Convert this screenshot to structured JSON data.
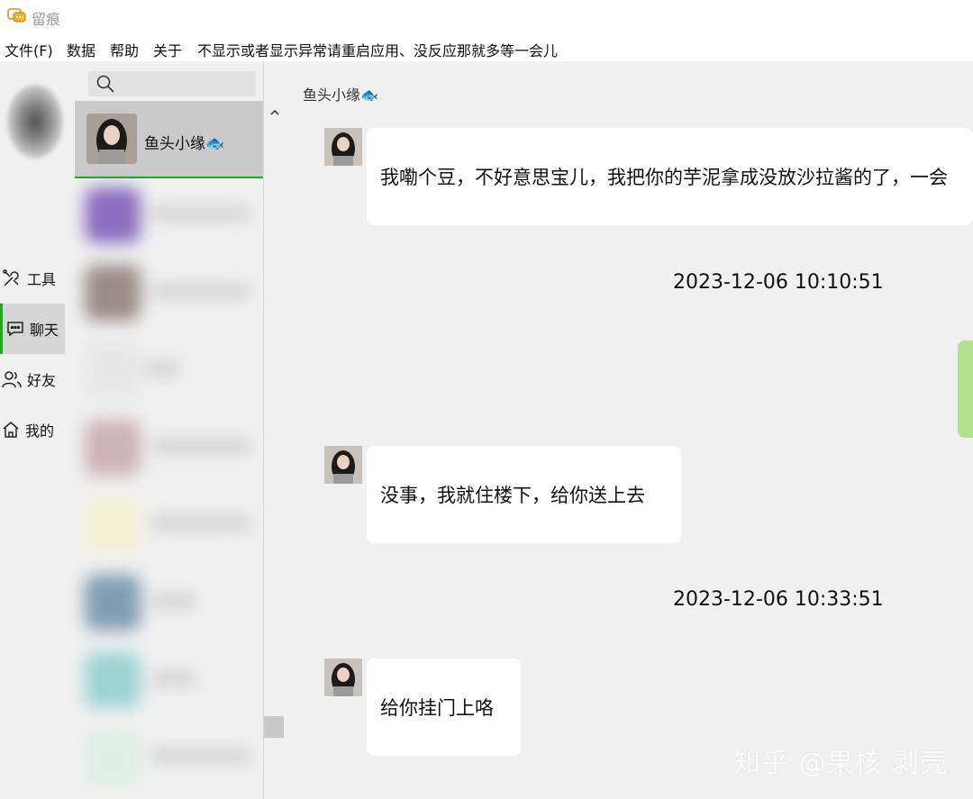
{
  "app": {
    "title": "留痕"
  },
  "menu": [
    {
      "label": "文件(F)"
    },
    {
      "label": "数据"
    },
    {
      "label": "帮助"
    },
    {
      "label": "关于"
    },
    {
      "label": "不显示或者显示异常请重启应用、没反应那就多等一会儿"
    }
  ],
  "nav": {
    "items": [
      {
        "label": "工具",
        "icon": "tools-icon"
      },
      {
        "label": "聊天",
        "icon": "chat-icon",
        "active": true
      },
      {
        "label": "好友",
        "icon": "friends-icon"
      },
      {
        "label": "我的",
        "icon": "home-icon"
      }
    ]
  },
  "contacts": {
    "active": {
      "name": "鱼头小缘🐟"
    }
  },
  "chat": {
    "title": "鱼头小缘🐟",
    "messages": [
      {
        "text": "我嘞个豆，不好意思宝儿，我把你的芋泥拿成没放沙拉酱的了，一会"
      },
      {
        "timestamp": "2023-12-06 10:10:51"
      },
      {
        "text": "没事，我就住楼下，给你送上去"
      },
      {
        "timestamp": "2023-12-06 10:33:51"
      },
      {
        "text": "给你挂门上咯"
      }
    ]
  },
  "watermark": "知乎 @果核 剥壳",
  "colors": {
    "accent": "#1aad19",
    "self_bubble": "#b3e28c",
    "background": "#f0f0f0"
  }
}
